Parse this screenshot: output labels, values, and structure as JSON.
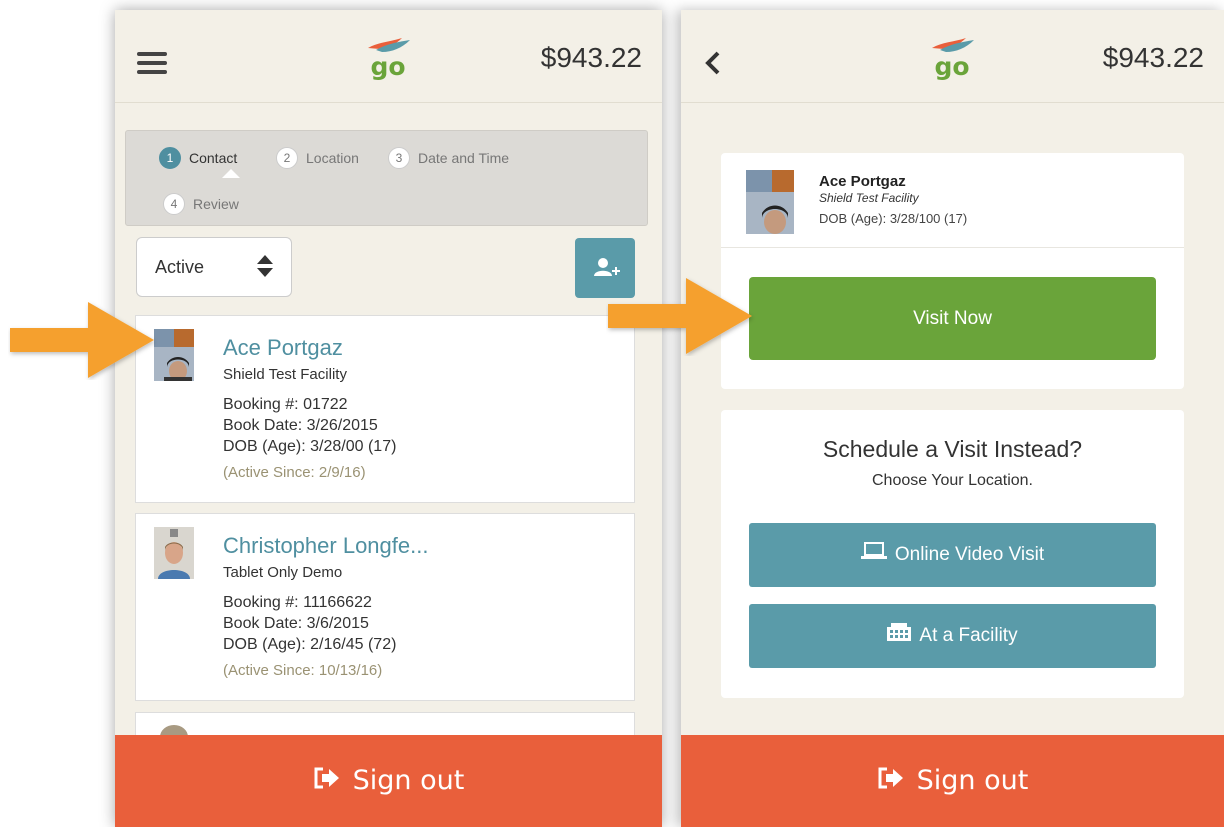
{
  "colors": {
    "background": "#f3f0e7",
    "teal": "#5a9ba9",
    "green": "#6aa43a",
    "signout": "#e95f3b",
    "orange_arrow": "#f5a02e",
    "active_since": "#9a9273"
  },
  "left_screen": {
    "header": {
      "menu_icon": "hamburger-icon",
      "logo_text": "go",
      "balance": "$943.22"
    },
    "stepper": {
      "steps": [
        {
          "num": "1",
          "label": "Contact",
          "active": true
        },
        {
          "num": "2",
          "label": "Location",
          "active": false
        },
        {
          "num": "3",
          "label": "Date and Time",
          "active": false
        },
        {
          "num": "4",
          "label": "Review",
          "active": false
        }
      ]
    },
    "filter": {
      "selected": "Active"
    },
    "add_contact_icon": "add-user-icon",
    "contacts": [
      {
        "name": "Ace Portgaz",
        "facility": "Shield Test Facility",
        "booking_label": "Booking #:",
        "booking": "01722",
        "book_date_label": "Book Date:",
        "book_date": "3/26/2015",
        "dob_label": "DOB (Age):",
        "dob": "3/28/00 (17)",
        "active_since": "(Active Since: 2/9/16)"
      },
      {
        "name": "Christopher Longfe...",
        "facility": "Tablet Only Demo",
        "booking_label": "Booking #:",
        "booking": "11166622",
        "book_date_label": "Book Date:",
        "book_date": "3/6/2015",
        "dob_label": "DOB (Age):",
        "dob": "2/16/45 (72)",
        "active_since": "(Active Since: 10/13/16)"
      }
    ],
    "signout_label": "Sign out"
  },
  "right_screen": {
    "header": {
      "back_icon": "chevron-left-icon",
      "logo_text": "go",
      "balance": "$943.22"
    },
    "profile": {
      "name": "Ace Portgaz",
      "facility": "Shield Test Facility",
      "dob_label": "DOB (Age):",
      "dob": "3/28/100 (17)"
    },
    "visit_now_label": "Visit Now",
    "schedule": {
      "title": "Schedule a Visit Instead?",
      "subtitle": "Choose Your Location.",
      "online_label": "Online Video Visit",
      "facility_label": "At a Facility"
    },
    "signout_label": "Sign out"
  }
}
